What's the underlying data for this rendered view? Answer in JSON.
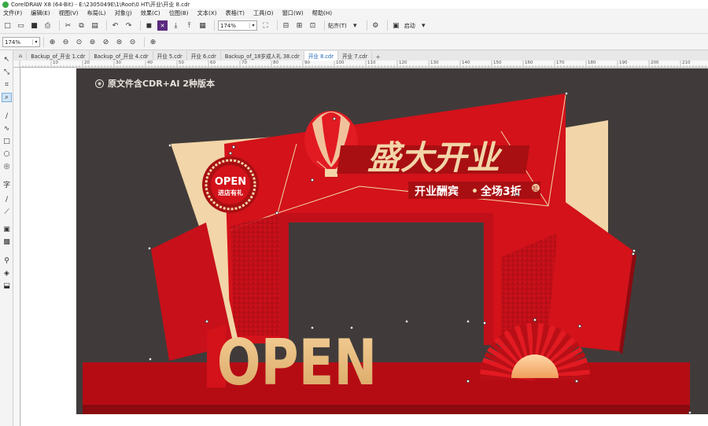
{
  "window": {
    "title": "CorelDRAW X8 (64-Bit) - E:\\2305049E\\1\\Root\\0 HT\\开业\\开业 8.cdr"
  },
  "menu": [
    "文件(F)",
    "编辑(E)",
    "视图(V)",
    "布局(L)",
    "对象(J)",
    "效果(C)",
    "位图(B)",
    "文本(X)",
    "表格(T)",
    "工具(O)",
    "窗口(W)",
    "帮助(H)"
  ],
  "toolbar": {
    "zoom_value": "174%",
    "snap_label": "贴齐(T)",
    "launch_label": "启动"
  },
  "property_bar": {
    "zoom_value": "174%"
  },
  "tabs": [
    "Backup_of_开业 1.cdr",
    "Backup_of_开业 4.cdr",
    "开业 5.cdr",
    "开业 6.cdr",
    "Backup_of_18岁成人礼 38.cdr",
    "开业 8.cdr",
    "开业 7.cdr"
  ],
  "active_tab": "开业 8.cdr",
  "ruler": {
    "labels": [
      "10",
      "20",
      "30",
      "40",
      "50",
      "60",
      "70",
      "80",
      "90",
      "100",
      "110",
      "120",
      "130",
      "140",
      "150",
      "160",
      "170",
      "180",
      "190",
      "200",
      "210"
    ]
  },
  "canvas": {
    "notice": "原文件含CDR+AI 2种版本",
    "headline": "盛大开业",
    "subline_left": "开业酬宾",
    "subline_dot": "•",
    "subline_right": "全场3折",
    "subline_badge": "起",
    "badge_top": "OPEN",
    "badge_bottom": "进店有礼",
    "big_word": "OPEN"
  },
  "colors": {
    "red": "#d3121a",
    "dark_red": "#a80f12",
    "cream": "#f2d5a8",
    "gold": "#e9b56f",
    "background": "#403b3a"
  }
}
